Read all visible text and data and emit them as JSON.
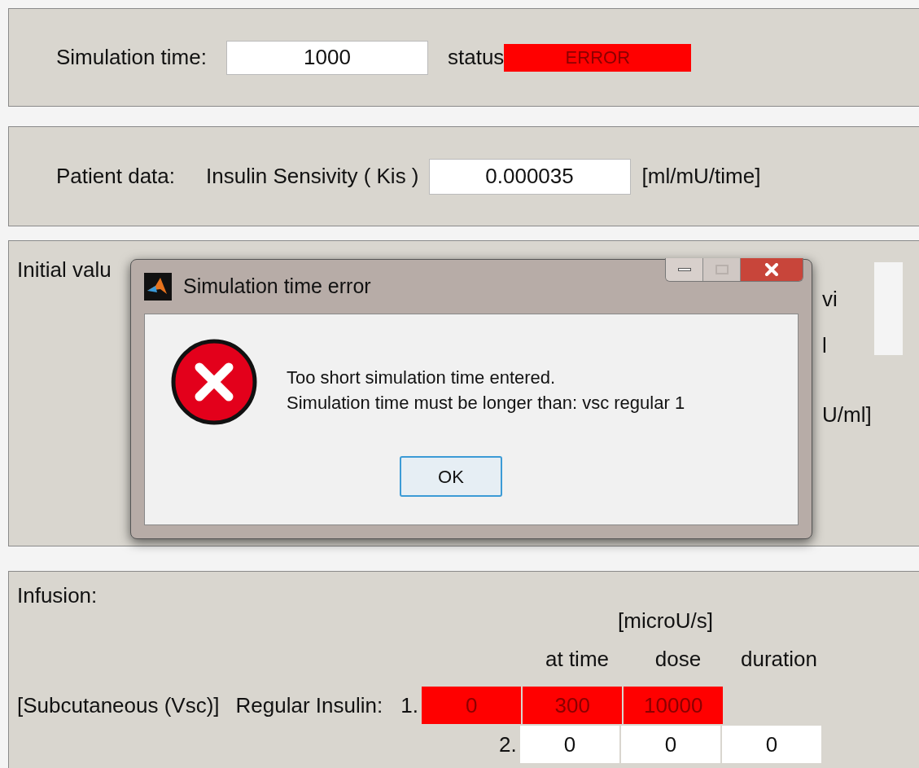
{
  "simulation": {
    "label": "Simulation time:",
    "value": "1000",
    "status_label": "status",
    "status_text": "ERROR",
    "status_error": true
  },
  "patient": {
    "label": "Patient data:",
    "field_label": "Insulin Sensivity ( Kis )",
    "value": "0.000035",
    "unit": "[ml/mU/time]"
  },
  "initial_values": {
    "label": "Initial valu",
    "fragments": [
      "vi",
      "l",
      "U/ml]"
    ]
  },
  "dialog": {
    "title": "Simulation time error",
    "message": [
      "Too short simulation time entered.",
      "Simulation time must be longer than: vsc regular 1"
    ],
    "button": "OK"
  },
  "infusion": {
    "label": "Infusion:",
    "unit": "[microU/s]",
    "columns": [
      "at time",
      "dose",
      "duration"
    ],
    "route": "[Subcutaneous (Vsc)]",
    "insulin": "Regular Insulin:",
    "rows": [
      {
        "index": "1.",
        "error": true,
        "values": [
          "0",
          "300",
          "10000"
        ]
      },
      {
        "index": "2.",
        "error": false,
        "values": [
          "0",
          "0",
          "0"
        ]
      }
    ]
  }
}
